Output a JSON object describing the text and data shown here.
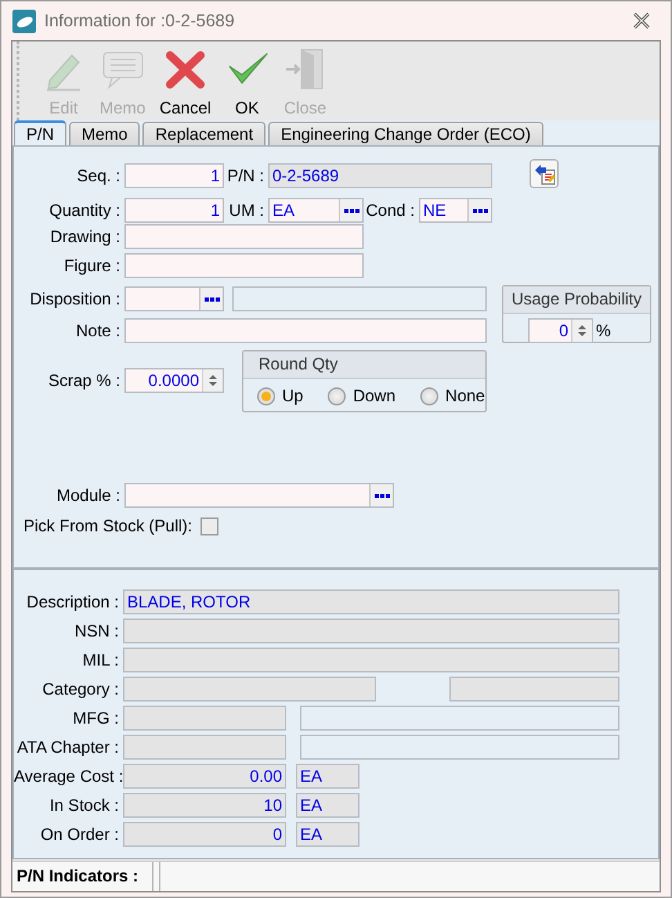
{
  "window": {
    "title": "Information for :0-2-5689"
  },
  "toolbar": [
    {
      "label": "Edit",
      "kind": "edit",
      "disabled": true
    },
    {
      "label": "Memo",
      "kind": "memo",
      "disabled": true
    },
    {
      "label": "Cancel",
      "kind": "cancel",
      "disabled": false
    },
    {
      "label": "OK",
      "kind": "ok",
      "disabled": false
    },
    {
      "label": "Close",
      "kind": "close",
      "disabled": true
    }
  ],
  "tabs": [
    {
      "label": "P/N",
      "selected": true
    },
    {
      "label": "Memo",
      "selected": false
    },
    {
      "label": "Replacement",
      "selected": false
    },
    {
      "label": "Engineering Change Order (ECO)",
      "selected": false
    }
  ],
  "top_form": {
    "seq": {
      "label": "Seq. :",
      "value": "1",
      "readonly": false
    },
    "pn": {
      "label": "P/N :",
      "value": "0-2-5689",
      "readonly": true
    },
    "quantity": {
      "label": "Quantity :",
      "value": "1",
      "readonly": false
    },
    "um": {
      "label": "UM :",
      "value": "EA",
      "readonly": false
    },
    "cond": {
      "label": "Cond :",
      "value": "NE",
      "readonly": false
    },
    "drawing": {
      "label": "Drawing :",
      "readonly": false
    },
    "figure": {
      "label": "Figure :",
      "readonly": false
    },
    "disposition": {
      "label": "Disposition :",
      "readonly": false
    },
    "note": {
      "label": "Note :",
      "readonly": false
    },
    "usage_probability": {
      "title": "Usage Probability",
      "value": "0",
      "unit": "%"
    },
    "scrap": {
      "label": "Scrap % :",
      "value": "0.0000",
      "readonly": false
    },
    "round_qty": {
      "title": "Round Qty",
      "options": [
        {
          "label": "Up",
          "selected": true
        },
        {
          "label": "Down",
          "selected": false
        },
        {
          "label": "None",
          "selected": false
        }
      ]
    },
    "module": {
      "label": "Module :",
      "readonly": false
    },
    "pick_from_stock": {
      "label": "Pick From Stock (Pull):",
      "checked": false
    }
  },
  "details": [
    {
      "label": "Description :",
      "value": "BLADE, ROTOR",
      "kind": "wide"
    },
    {
      "label": "NSN :",
      "kind": "wide"
    },
    {
      "label": "MIL :",
      "kind": "wide"
    },
    {
      "label": "Category :",
      "kind": "split"
    },
    {
      "label": "MFG :",
      "kind": "pair"
    },
    {
      "label": "ATA Chapter :",
      "kind": "pair"
    },
    {
      "label": "Average Cost :",
      "value": "0.00",
      "unit": "EA",
      "kind": "amount"
    },
    {
      "label": "In Stock :",
      "value": "10",
      "unit": "EA",
      "kind": "amount"
    },
    {
      "label": "On Order :",
      "value": "0",
      "unit": "EA",
      "kind": "amount"
    }
  ],
  "status_bar": {
    "label": "P/N Indicators :"
  }
}
